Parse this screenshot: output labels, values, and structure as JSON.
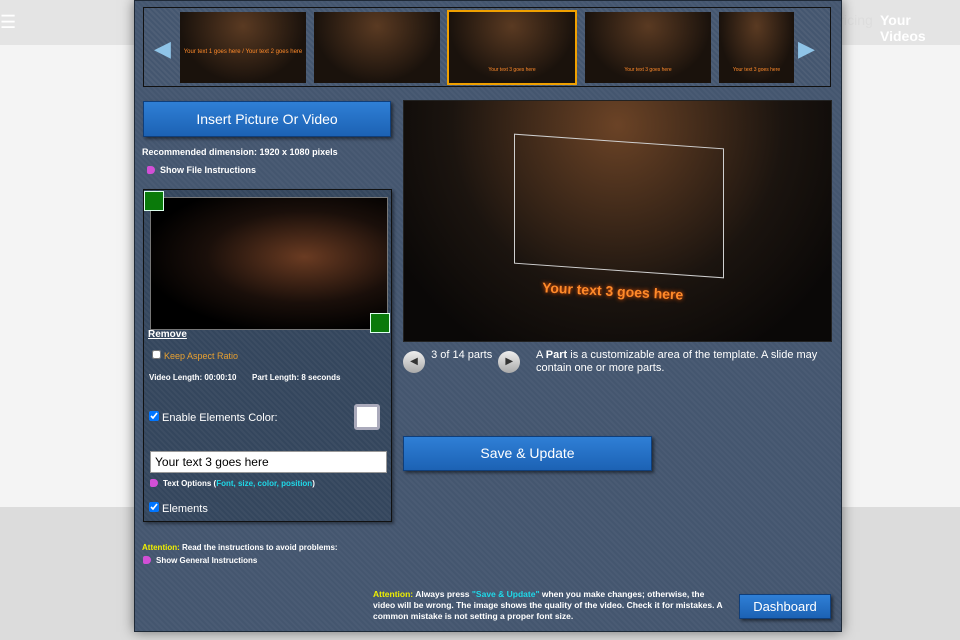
{
  "nav": {
    "menu_icon": "☰",
    "pricing": "Pricing",
    "your_videos": "Your Videos"
  },
  "strip": {
    "prev": "◀",
    "next": "▶",
    "thumbs": [
      "Your text 1 goes here / Your text 2 goes here",
      "",
      "Your text 3 goes here",
      "Your text 3 goes here",
      "Your text 3 goes here"
    ]
  },
  "insert_label": "Insert Picture Or Video",
  "recommended": "Recommended dimension: 1920 x 1080 pixels",
  "show_file_instructions": "Show File Instructions",
  "remove": "Remove",
  "keep_aspect": "Keep Aspect Ratio",
  "video_length": "Video Length:  00:00:10",
  "part_length": "Part Length:  8 seconds",
  "enable_color": "Enable Elements Color:",
  "text_value": "Your text 3 goes here",
  "text_options": "Text Options (",
  "text_options_detail": "Font, size, color, position",
  "text_options_close": ")",
  "elements": "Elements",
  "attention_label": "Attention:",
  "attention_general": "Read the instructions to avoid problems:",
  "show_general": "Show General Instructions",
  "preview_text": "Your text 3 goes here",
  "parts": {
    "prev": "◀",
    "label": "3 of 14 parts",
    "next": "▶"
  },
  "part_desc_bold": "Part",
  "part_desc_pre": "A ",
  "part_desc": " is a customizable area of the template. A slide may contain one or more parts.",
  "save_label": "Save & Update",
  "bottom_attention": {
    "label": "Attention:",
    "pre": "Always press ",
    "hl": "\"Save & Update\"",
    "post": " when you make changes; otherwise, the video will be wrong. The image shows the quality of the video. Check it for mistakes. A common mistake is not setting a proper font size."
  },
  "dashboard": "Dashboard"
}
